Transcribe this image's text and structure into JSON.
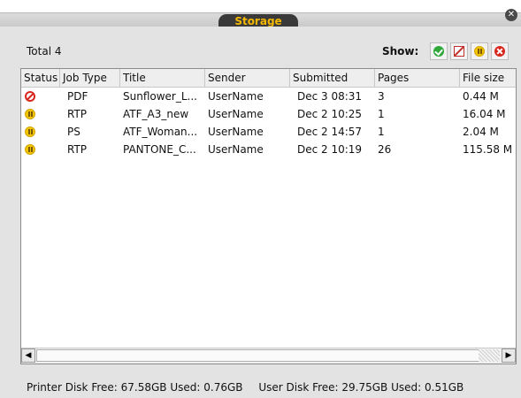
{
  "window": {
    "tab_title": "Storage",
    "close_icon": "close-icon"
  },
  "summary": {
    "total": "Total 4"
  },
  "filters": {
    "label": "Show:",
    "buttons": [
      {
        "name": "filter-completed",
        "icon": "check-icon"
      },
      {
        "name": "filter-deleted",
        "icon": "deleted-icon"
      },
      {
        "name": "filter-paused",
        "icon": "pause-icon"
      },
      {
        "name": "filter-error",
        "icon": "error-icon"
      }
    ]
  },
  "table": {
    "columns": [
      "Status",
      "Job Type",
      "Title",
      "Sender",
      "Submitted",
      "Pages",
      "File size"
    ],
    "rows": [
      {
        "status": "cancelled",
        "job_type": "PDF",
        "title": "Sunflower_L...",
        "sender": "UserName",
        "submitted": "Dec 3 08:31",
        "pages": "3",
        "file_size": "0.44 M"
      },
      {
        "status": "paused",
        "job_type": "RTP",
        "title": "ATF_A3_new",
        "sender": "UserName",
        "submitted": "Dec 2 10:25",
        "pages": "1",
        "file_size": "16.04 M"
      },
      {
        "status": "paused",
        "job_type": "PS",
        "title": "ATF_Woman...",
        "sender": "UserName",
        "submitted": "Dec 2 14:57",
        "pages": "1",
        "file_size": "2.04 M"
      },
      {
        "status": "paused",
        "job_type": "RTP",
        "title": "PANTONE_C...",
        "sender": "UserName",
        "submitted": "Dec 2 10:19",
        "pages": "26",
        "file_size": "115.58 M"
      }
    ]
  },
  "footer": {
    "printer_disk": "Printer Disk Free: 67.58GB Used: 0.76GB",
    "user_disk": "User Disk Free: 29.75GB Used: 0.51GB"
  },
  "colors": {
    "accent_tab_text": "#f5b800",
    "ok": "#2fa83a",
    "paused": "#f3c400",
    "error": "#d9261c"
  }
}
